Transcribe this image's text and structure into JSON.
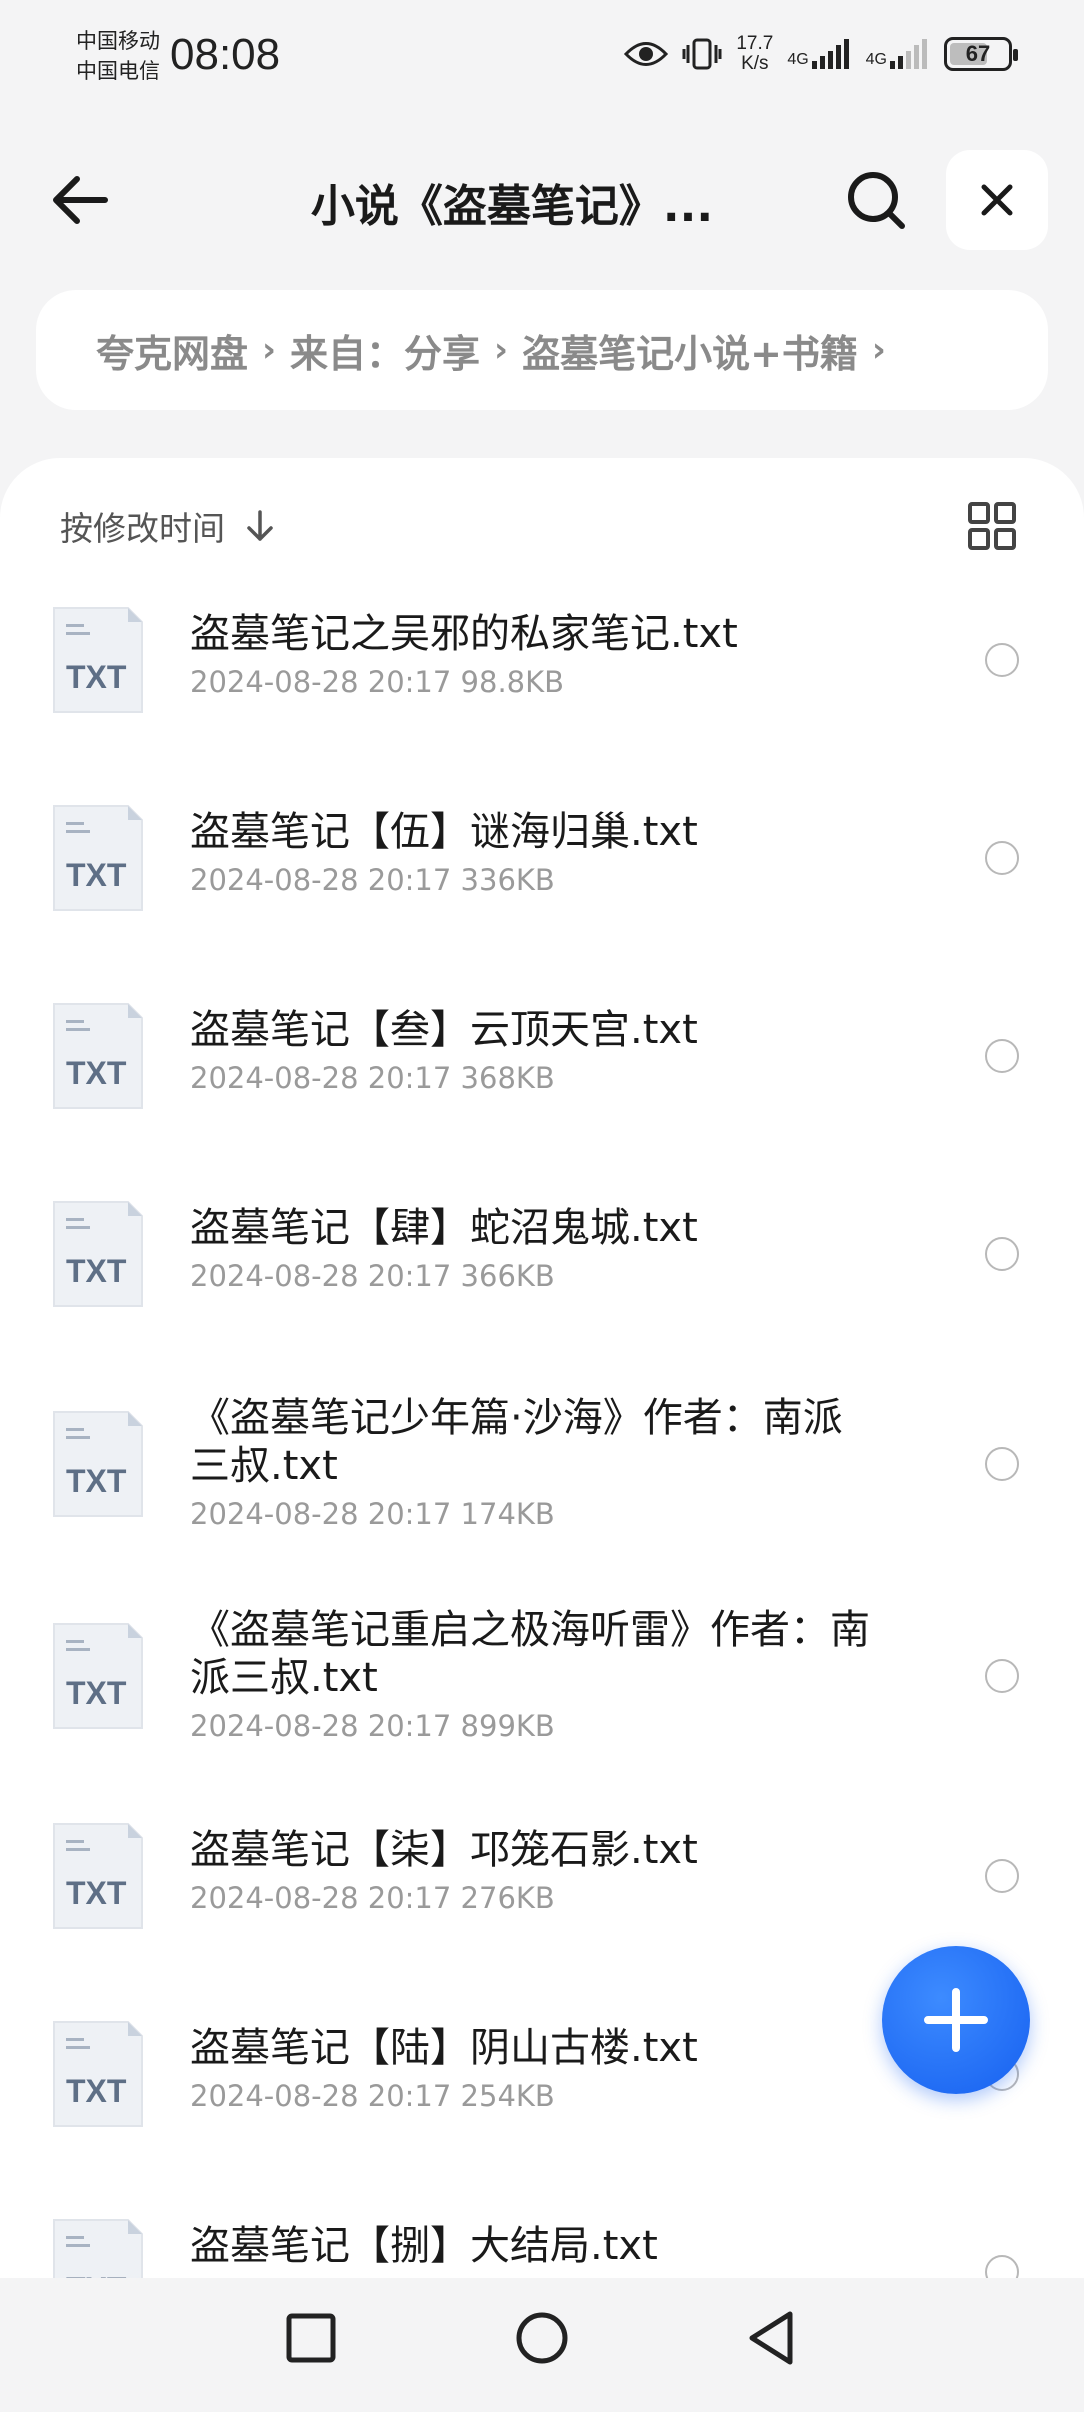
{
  "status_bar": {
    "carrier_1": "中国移动",
    "carrier_2": "中国电信",
    "time": "08:08",
    "net_speed_value": "17.7",
    "net_speed_unit": "K/s",
    "signal_1_label": "4G",
    "signal_2_label": "4G",
    "battery": "67"
  },
  "header": {
    "title": "小说《盗墓笔记》..."
  },
  "breadcrumb": [
    "夸克网盘",
    "来自：分享",
    "盗墓笔记小说+书籍"
  ],
  "sort": {
    "label": "按修改时间"
  },
  "file_type_label": "TXT",
  "files": [
    {
      "name": "盗墓笔记之吴邪的私家笔记.txt",
      "meta": "2024-08-28 20:17  98.8KB"
    },
    {
      "name": "盗墓笔记【伍】谜海归巢.txt",
      "meta": "2024-08-28 20:17  336KB"
    },
    {
      "name": "盗墓笔记【叁】云顶天宫.txt",
      "meta": "2024-08-28 20:17  368KB"
    },
    {
      "name": "盗墓笔记【肆】蛇沼鬼城.txt",
      "meta": "2024-08-28 20:17  366KB"
    },
    {
      "name": "《盗墓笔记少年篇·沙海》作者：南派三叔.txt",
      "meta": "2024-08-28 20:17  174KB"
    },
    {
      "name": "《盗墓笔记重启之极海听雷》作者：南派三叔.txt",
      "meta": "2024-08-28 20:17  899KB"
    },
    {
      "name": "盗墓笔记【柒】邛笼石影.txt",
      "meta": "2024-08-28 20:17  276KB"
    },
    {
      "name": "盗墓笔记【陆】阴山古楼.txt",
      "meta": "2024-08-28 20:17  254KB"
    },
    {
      "name": "盗墓笔记【捌】大结局.txt",
      "meta": ""
    }
  ],
  "colors": {
    "accent": "#1660f0",
    "background": "#f4f4f5",
    "muted_text": "#9a9a9a"
  },
  "icons": [
    "back-arrow-icon",
    "search-icon",
    "close-icon",
    "sort-down-icon",
    "grid-view-icon",
    "txt-file-icon",
    "plus-icon",
    "home-square-icon",
    "home-circle-icon",
    "back-triangle-icon"
  ]
}
